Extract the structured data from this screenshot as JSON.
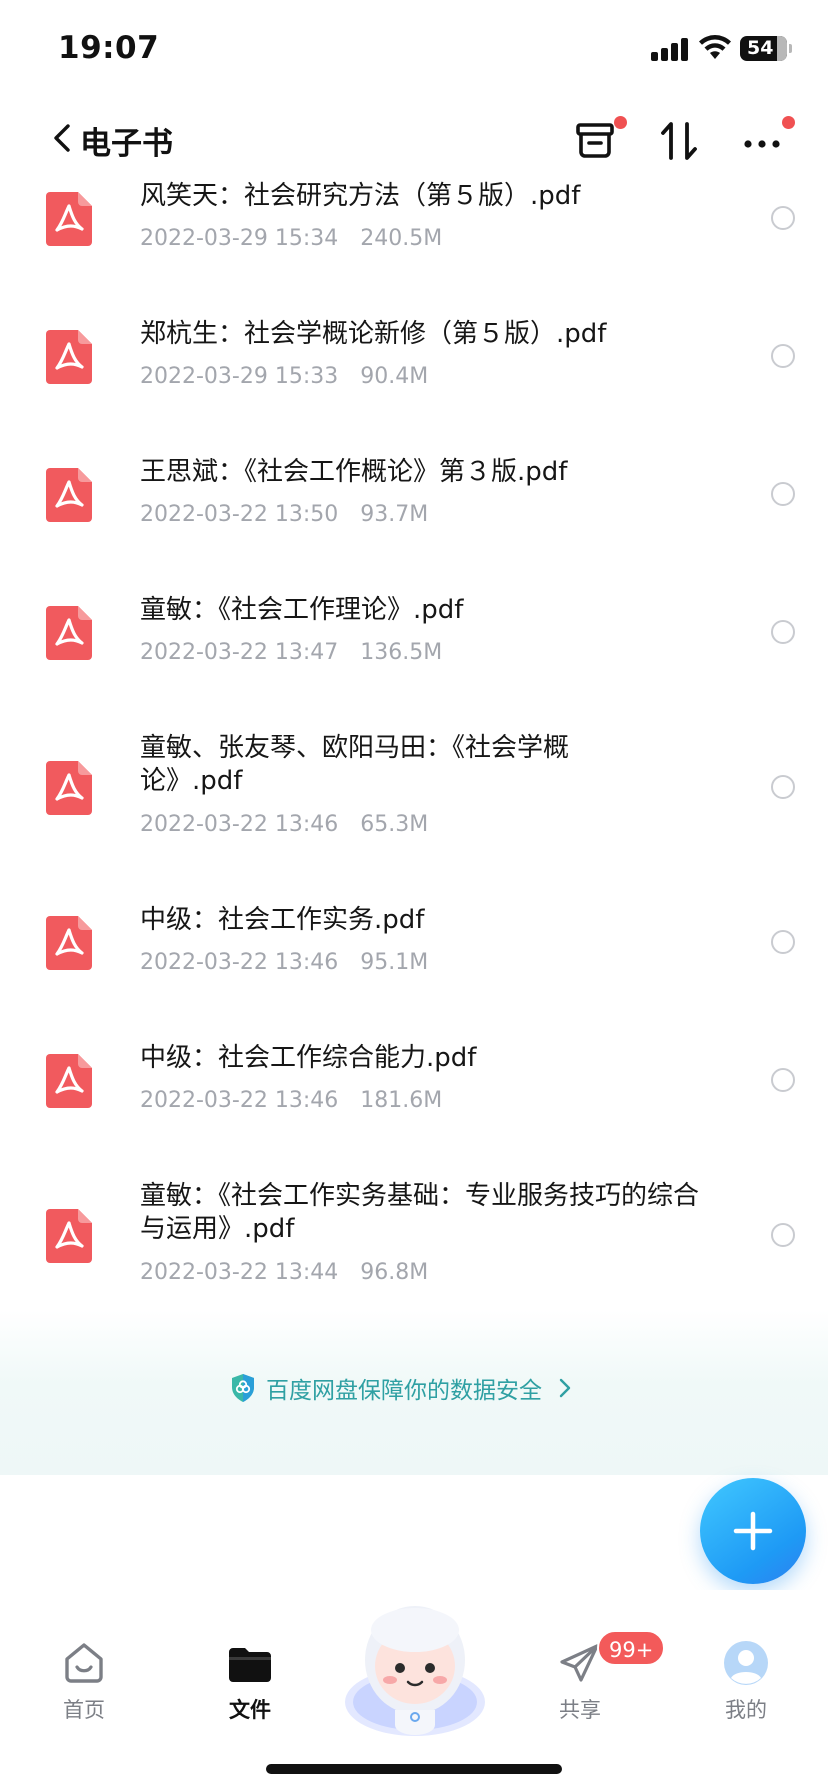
{
  "status_bar": {
    "time": "19:07",
    "battery": "54"
  },
  "nav": {
    "title": "电子书",
    "icons": [
      "chevron-left-icon",
      "transfer-box-icon",
      "sort-icon",
      "more-icon"
    ],
    "red_dot_color": "#f05152"
  },
  "files": [
    {
      "name": "风笑天：社会研究方法（第５版）.pdf",
      "date": "2022-03-29 15:34",
      "size": "240.5M"
    },
    {
      "name": "郑杭生：社会学概论新修（第５版）.pdf",
      "date": "2022-03-29 15:33",
      "size": "90.4M"
    },
    {
      "name": "王思斌：《社会工作概论》第３版.pdf",
      "date": "2022-03-22 13:50",
      "size": "93.7M"
    },
    {
      "name": "童敏：《社会工作理论》.pdf",
      "date": "2022-03-22 13:47",
      "size": "136.5M"
    },
    {
      "name": "童敏、张友琴、欧阳马田：《社会学概论》.pdf",
      "date": "2022-03-22 13:46",
      "size": "65.3M"
    },
    {
      "name": "中级：社会工作实务.pdf",
      "date": "2022-03-22 13:46",
      "size": "95.1M"
    },
    {
      "name": "中级：社会工作综合能力.pdf",
      "date": "2022-03-22 13:46",
      "size": "181.6M"
    },
    {
      "name": "童敏：《社会工作实务基础：专业服务技巧的综合与运用》.pdf",
      "date": "2022-03-22 13:44",
      "size": "96.8M"
    }
  ],
  "security_banner": {
    "text": "百度网盘保障你的数据安全",
    "icon": "shield-icon",
    "color": "#2fa0a3"
  },
  "fab": {
    "icon": "plus-icon",
    "color": "#1e9af5"
  },
  "tabbar": {
    "tabs": [
      {
        "label": "首页",
        "icon": "home-icon"
      },
      {
        "label": "文件",
        "icon": "folder-icon",
        "active": true
      },
      {
        "label": "共享",
        "icon": "paper-plane-icon"
      },
      {
        "label": "我的",
        "icon": "avatar-icon"
      }
    ],
    "share_badge": "99+",
    "badge_color": "#f35a5a"
  },
  "pdf_icon_color": "#f15a5e"
}
